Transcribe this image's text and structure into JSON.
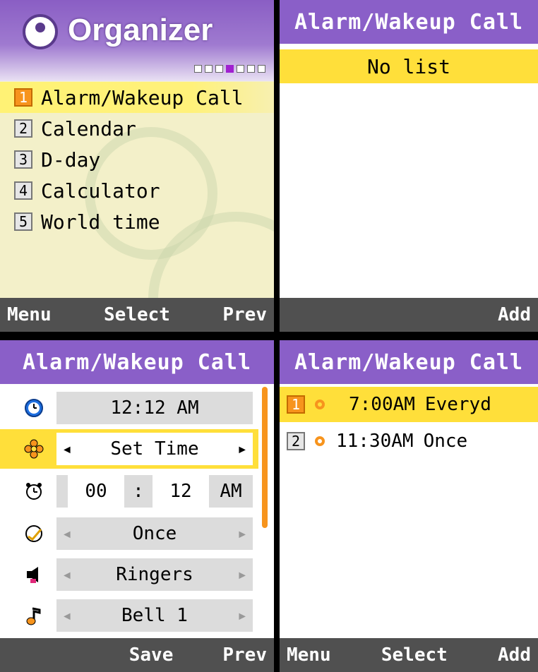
{
  "organizer": {
    "title": "Organizer",
    "page_dots": 7,
    "active_dot": 4,
    "items": [
      {
        "num": "1",
        "label": "Alarm/Wakeup Call",
        "selected": true
      },
      {
        "num": "2",
        "label": "Calendar"
      },
      {
        "num": "3",
        "label": "D-day"
      },
      {
        "num": "4",
        "label": "Calculator"
      },
      {
        "num": "5",
        "label": "World time"
      }
    ],
    "softkeys": {
      "left": "Menu",
      "center": "Select",
      "right": "Prev"
    }
  },
  "alarm_empty": {
    "title": "Alarm/Wakeup Call",
    "message": "No list",
    "softkeys": {
      "right": "Add"
    }
  },
  "alarm_edit": {
    "title": "Alarm/Wakeup Call",
    "current_time": "12:12 AM",
    "mode": "Set Time",
    "hour": "00",
    "separator": ":",
    "minute": "12",
    "ampm": "AM",
    "repeat": "Once",
    "sound_type": "Ringers",
    "sound": "Bell 1",
    "softkeys": {
      "center": "Save",
      "right": "Prev"
    }
  },
  "alarm_list": {
    "title": "Alarm/Wakeup Call",
    "items": [
      {
        "num": "1",
        "time": "7:00AM",
        "repeat": "Everyd"
      },
      {
        "num": "2",
        "time": "11:30AM",
        "repeat": "Once"
      }
    ],
    "softkeys": {
      "left": "Menu",
      "center": "Select",
      "right": "Add"
    }
  },
  "colors": {
    "title_bar": "#8a5fc8",
    "highlight": "#ffdf3a",
    "accent": "#f7941d",
    "softkey_bar": "#505050"
  }
}
